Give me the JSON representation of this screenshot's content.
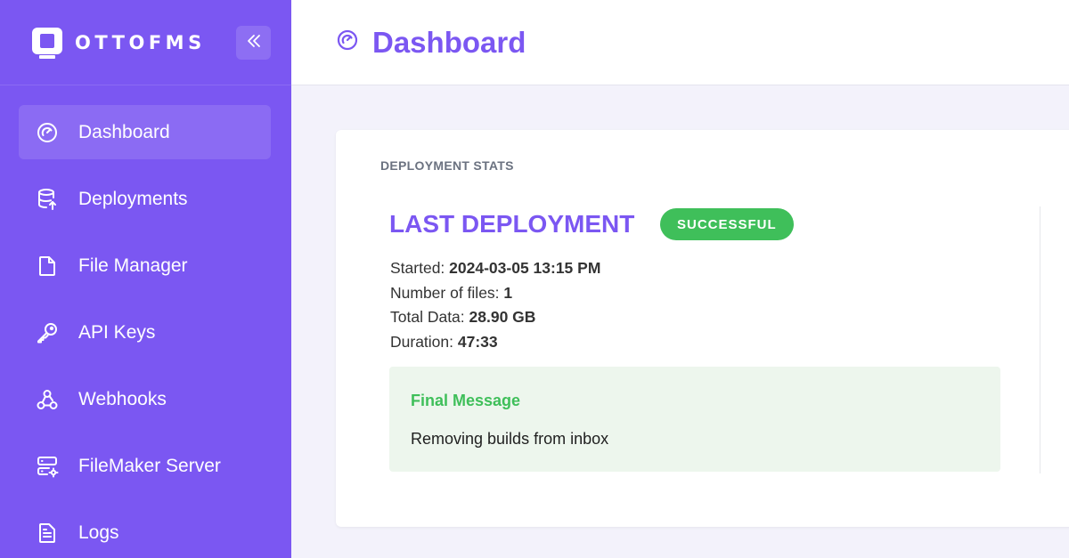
{
  "brand": {
    "name": "OTTOFMS"
  },
  "colors": {
    "accent": "#7b57f2",
    "success": "#3fbf5a",
    "success_bg": "#edf6ed"
  },
  "sidebar": {
    "collapse_icon": "chevrons-left-icon",
    "items": [
      {
        "label": "Dashboard",
        "icon": "gauge-icon",
        "active": true
      },
      {
        "label": "Deployments",
        "icon": "database-upload-icon",
        "active": false
      },
      {
        "label": "File Manager",
        "icon": "file-icon",
        "active": false
      },
      {
        "label": "API Keys",
        "icon": "key-icon",
        "active": false
      },
      {
        "label": "Webhooks",
        "icon": "webhook-icon",
        "active": false
      },
      {
        "label": "FileMaker Server",
        "icon": "server-gear-icon",
        "active": false
      },
      {
        "label": "Logs",
        "icon": "log-file-icon",
        "active": false
      }
    ]
  },
  "header": {
    "title": "Dashboard",
    "icon": "gauge-icon"
  },
  "deployment_stats": {
    "section_label": "DEPLOYMENT STATS",
    "title": "LAST DEPLOYMENT",
    "status": "SUCCESSFUL",
    "stats": [
      {
        "label": "Started:",
        "value": "2024-03-05 13:15 PM"
      },
      {
        "label": "Number of files:",
        "value": "1"
      },
      {
        "label": "Total Data:",
        "value": "28.90 GB"
      },
      {
        "label": "Duration:",
        "value": "47:33"
      }
    ],
    "final_message": {
      "title": "Final Message",
      "text": "Removing builds from inbox"
    }
  }
}
